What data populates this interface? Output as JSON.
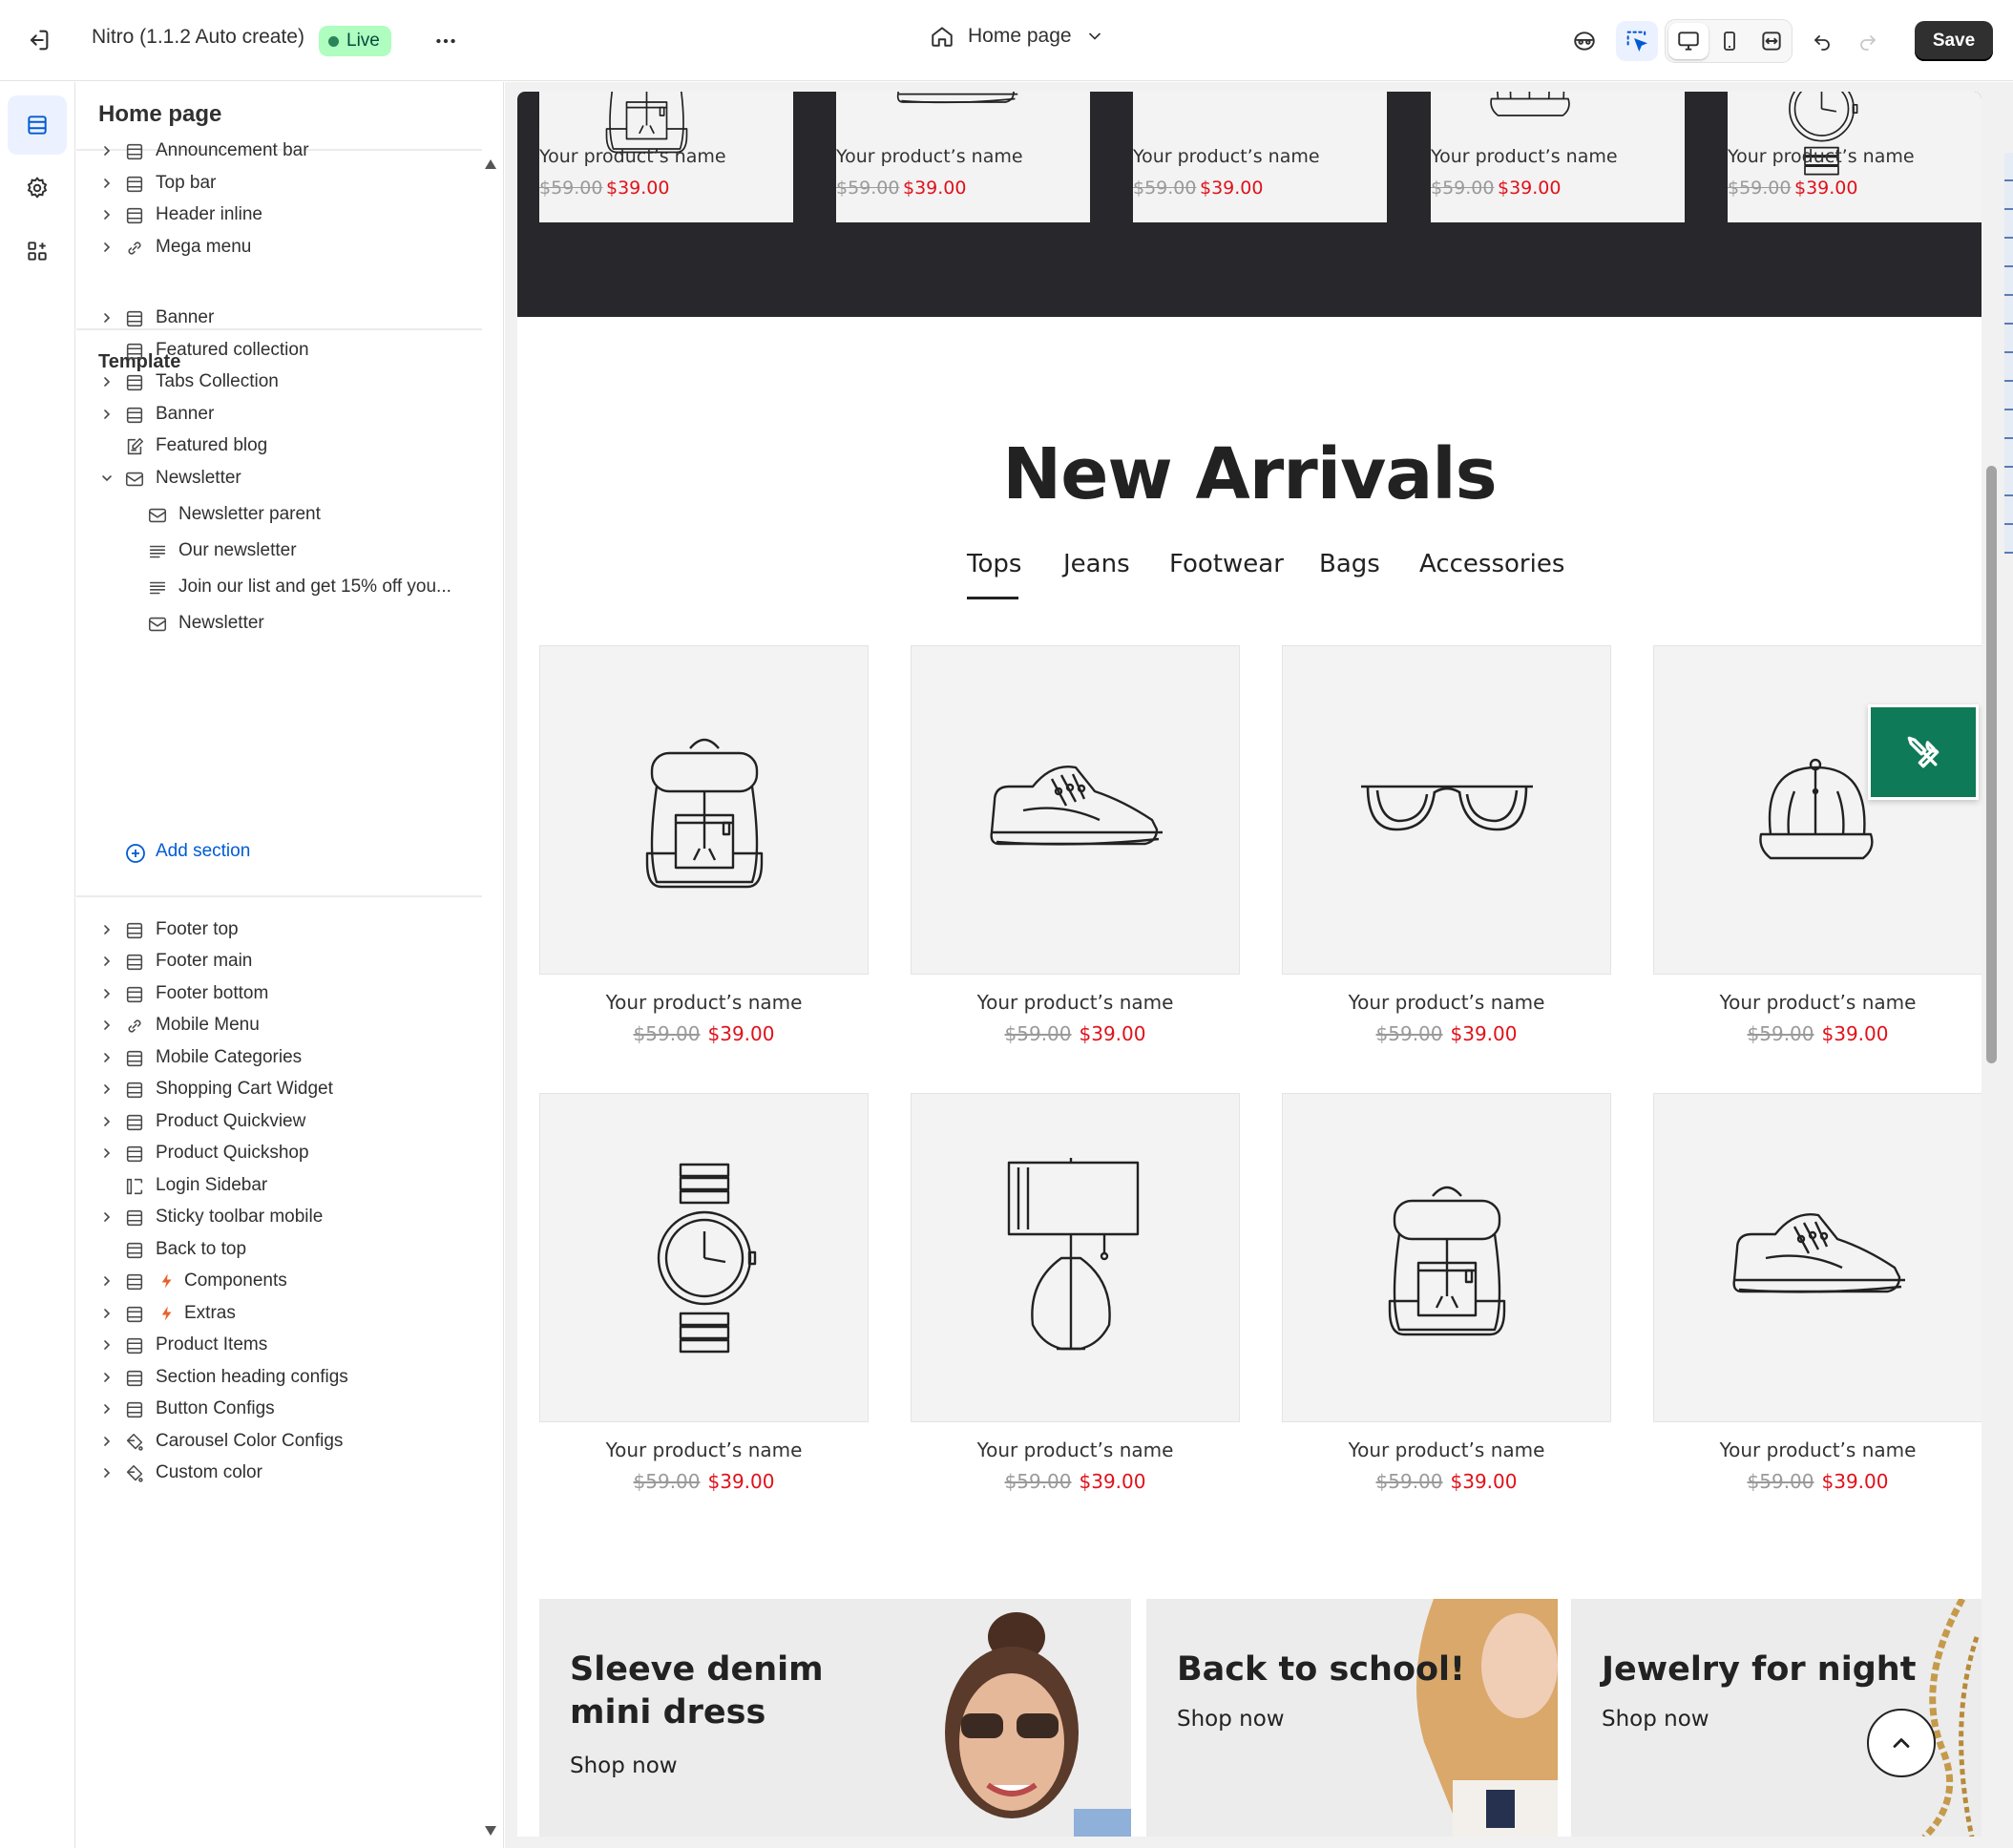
{
  "topbar": {
    "title": "Nitro (1.1.2 Auto create)",
    "status": "Live",
    "page_selector": "Home page",
    "save_label": "Save",
    "colors": {
      "live_bg": "#affebf",
      "live_text": "#014b40",
      "save_bg": "#303030",
      "accent": "#005bd3"
    }
  },
  "sidebar": {
    "title": "Home page",
    "header_items": [
      {
        "label": "Announcement bar",
        "icon": "section-icon"
      },
      {
        "label": "Top bar",
        "icon": "section-icon"
      },
      {
        "label": "Header inline",
        "icon": "section-icon"
      },
      {
        "label": "Mega menu",
        "icon": "link-icon"
      }
    ],
    "template_label": "Template",
    "template_items": [
      {
        "label": "Banner",
        "icon": "section-icon"
      },
      {
        "label": "Featured collection",
        "icon": "section-icon"
      },
      {
        "label": "Tabs Collection",
        "icon": "section-icon"
      },
      {
        "label": "Banner",
        "icon": "section-icon"
      },
      {
        "label": "Featured blog",
        "icon": "blog-icon"
      },
      {
        "label": "Newsletter",
        "icon": "mail-icon"
      }
    ],
    "newsletter_children": [
      {
        "label": "Newsletter parent",
        "icon": "mail-icon"
      },
      {
        "label": "Our newsletter",
        "icon": "text-icon"
      },
      {
        "label": "Join our list and get 15% off you...",
        "icon": "text-icon"
      },
      {
        "label": "Newsletter",
        "icon": "mail-icon"
      }
    ],
    "add_section": "Add section",
    "footer_items": [
      {
        "label": "Footer top",
        "icon": "section-icon"
      },
      {
        "label": "Footer main",
        "icon": "section-icon"
      },
      {
        "label": "Footer bottom",
        "icon": "section-icon"
      },
      {
        "label": "Mobile Menu",
        "icon": "link-icon"
      },
      {
        "label": "Mobile Categories",
        "icon": "section-icon"
      },
      {
        "label": "Shopping Cart Widget",
        "icon": "section-icon"
      },
      {
        "label": "Product Quickview",
        "icon": "section-icon"
      },
      {
        "label": "Product Quickshop",
        "icon": "section-icon"
      },
      {
        "label": "Login Sidebar",
        "icon": "sidebar-icon"
      },
      {
        "label": "Sticky toolbar mobile",
        "icon": "section-icon"
      },
      {
        "label": "Back to top",
        "icon": "section-icon"
      },
      {
        "label": "Components",
        "icon": "section-icon"
      },
      {
        "label": "Extras",
        "icon": "section-icon"
      },
      {
        "label": "Product Items",
        "icon": "section-icon"
      },
      {
        "label": "Section heading configs",
        "icon": "section-icon"
      },
      {
        "label": "Button Configs",
        "icon": "section-icon"
      },
      {
        "label": "Carousel Color Configs",
        "icon": "paint-icon"
      },
      {
        "label": "Custom color",
        "icon": "paint-icon"
      }
    ]
  },
  "preview": {
    "strip_products": [
      {
        "name": "Your product’s name",
        "old_price": "$59.00",
        "price": "$39.00",
        "icon": "backpack-icon"
      },
      {
        "name": "Your product’s name",
        "old_price": "$59.00",
        "price": "$39.00",
        "icon": "sneaker-icon"
      },
      {
        "name": "Your product’s name",
        "old_price": "$59.00",
        "price": "$39.00",
        "icon": "glasses-icon"
      },
      {
        "name": "Your product’s name",
        "old_price": "$59.00",
        "price": "$39.00",
        "icon": "cap-icon"
      },
      {
        "name": "Your product’s name",
        "old_price": "$59.00",
        "price": "$39.00",
        "icon": "watch-icon"
      }
    ],
    "section_title": "New Arrivals",
    "tabs": [
      "Tops",
      "Jeans",
      "Footwear",
      "Bags",
      "Accessories"
    ],
    "products": [
      {
        "name": "Your product’s name",
        "old_price": "$59.00",
        "price": "$39.00",
        "icon": "backpack-icon"
      },
      {
        "name": "Your product’s name",
        "old_price": "$59.00",
        "price": "$39.00",
        "icon": "sneaker-icon"
      },
      {
        "name": "Your product’s name",
        "old_price": "$59.00",
        "price": "$39.00",
        "icon": "glasses-icon"
      },
      {
        "name": "Your product’s name",
        "old_price": "$59.00",
        "price": "$39.00",
        "icon": "cap-icon"
      },
      {
        "name": "Your product’s name",
        "old_price": "$59.00",
        "price": "$39.00",
        "icon": "watch-icon"
      },
      {
        "name": "Your product’s name",
        "old_price": "$59.00",
        "price": "$39.00",
        "icon": "lamp-icon"
      },
      {
        "name": "Your product’s name",
        "old_price": "$59.00",
        "price": "$39.00",
        "icon": "backpack-icon"
      },
      {
        "name": "Your product’s name",
        "old_price": "$59.00",
        "price": "$39.00",
        "icon": "sneaker-icon"
      }
    ],
    "banners": [
      {
        "title_line1": "Sleeve denim",
        "title_line2": "mini dress",
        "cta": "Shop now"
      },
      {
        "title_line1": "Back to school!",
        "cta": "Shop now"
      },
      {
        "title_line1": "Jewelry for night",
        "cta": "Shop now"
      }
    ],
    "colors": {
      "dark_band": "#28272c",
      "sale_price": "#e0111a",
      "tools_button": "#0f7a57"
    }
  }
}
